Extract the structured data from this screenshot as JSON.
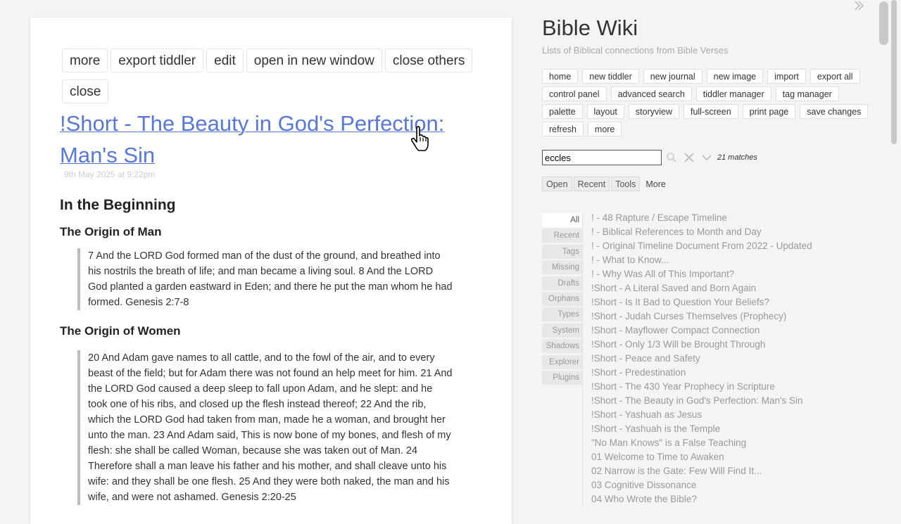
{
  "tiddler": {
    "toolbar_row1": [
      "more",
      "export tiddler",
      "edit",
      "open in new window",
      "close others"
    ],
    "toolbar_row2": [
      "close"
    ],
    "title": "!Short - The Beauty in God's Perfection: Man's Sin",
    "date": "9th May 2025 at 9:22pm",
    "h2": "In the Beginning",
    "section1_heading": "The Origin of Man",
    "section1_quote": "7 And the LORD God formed man of the dust of the ground, and breathed into his nostrils the breath of life; and man became a living soul. 8 And the LORD God planted a garden eastward in Eden; and there he put the man whom he had formed. Genesis 2:7-8",
    "section2_heading": "The Origin of Women",
    "section2_quote": "20 And Adam gave names to all cattle, and to the fowl of the air, and to every beast of the field; but for Adam there was not found an help meet for him. 21 And the LORD God caused a deep sleep to fall upon Adam, and he slept: and he took one of his ribs, and closed up the flesh instead thereof; 22 And the rib, which the LORD God had taken from man, made he a woman, and brought her unto the man. 23 And Adam said, This is now bone of my bones, and flesh of my flesh: she shall be called Woman, because she was taken out of Man. 24 Therefore shall a man leave his father and his mother, and shall cleave unto his wife: and they shall be one flesh. 25 And they were both naked, the man and his wife, and were not ashamed. Genesis 2:20-25"
  },
  "sidebar": {
    "site_title": "Bible Wiki",
    "site_subtitle": "Lists of Biblical connections from Bible Verses",
    "page_buttons": [
      "home",
      "new tiddler",
      "new journal",
      "new image",
      "import",
      "export all",
      "control panel",
      "advanced search",
      "tiddler manager",
      "tag manager",
      "palette",
      "layout",
      "storyview",
      "full-screen",
      "print page",
      "save changes",
      "refresh",
      "more"
    ],
    "search_value": "eccles",
    "matches": "21 matches",
    "tabs": [
      "Open",
      "Recent",
      "Tools",
      "More"
    ],
    "vertical_tabs": [
      "All",
      "Recent",
      "Tags",
      "Missing",
      "Drafts",
      "Orphans",
      "Types",
      "System",
      "Shadows",
      "Explorer",
      "Plugins"
    ],
    "list_items": [
      "! - 48 Rapture / Escape Timeline",
      "! - Biblical References to Month and Day",
      "! - Original Timeline Document From 2022 - Updated",
      "! - What to Know...",
      "! - Why Was All of This Important?",
      "!Short - A Literal Saved and Born Again",
      "!Short - Is It Bad to Question Your Beliefs?",
      "!Short - Judah Curses Themselves (Prophecy)",
      "!Short - Mayflower Compact Connection",
      "!Short - Only 1/3 Will be Brought Through",
      "!Short - Peace and Safety",
      "!Short - Predestination",
      "!Short - The 430 Year Prophecy in Scripture",
      "!Short - The Beauty in God's Perfection: Man's Sin",
      "!Short - Yashuah as Jesus",
      "!Short - Yashuah is the Temple",
      "\"No Man Knows\" is a False Teaching",
      "01 Welcome to Time to Awaken",
      "02 Narrow is the Gate: Few Will Find It...",
      "03 Cognitive Dissonance",
      "04 Who Wrote the Bible?"
    ]
  },
  "colors": {
    "link": "#5778d8",
    "page_bg": "#f4f4f4",
    "list_text": "#999999"
  }
}
